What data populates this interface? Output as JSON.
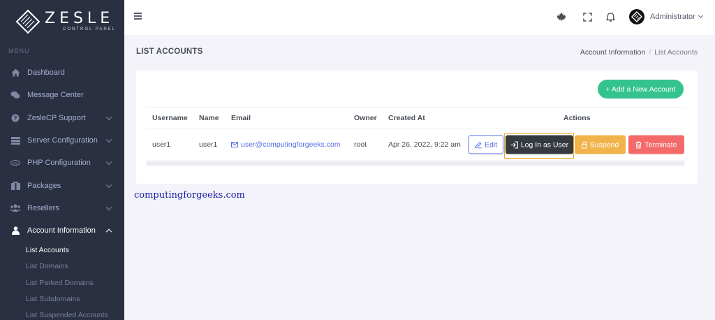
{
  "brand": {
    "name": "ZESLE",
    "tagline": "CONTROL PANEL"
  },
  "sidebar": {
    "menu_title": "MENU",
    "items": [
      {
        "label": "Dashboard",
        "icon": "home-icon",
        "has_children": false
      },
      {
        "label": "Message Center",
        "icon": "chat-icon",
        "has_children": false
      },
      {
        "label": "ZesleCP Support",
        "icon": "question-icon",
        "has_children": true
      },
      {
        "label": "Server Configuration",
        "icon": "server-icon",
        "has_children": true
      },
      {
        "label": "PHP Configuration",
        "icon": "php-icon",
        "has_children": true
      },
      {
        "label": "Packages",
        "icon": "package-icon",
        "has_children": true
      },
      {
        "label": "Resellers",
        "icon": "users-icon",
        "has_children": true
      },
      {
        "label": "Account Information",
        "icon": "user-icon",
        "has_children": true,
        "expanded": true
      }
    ],
    "subitems": [
      {
        "label": "List Accounts",
        "active": true
      },
      {
        "label": "List Domains"
      },
      {
        "label": "List Parked Domains"
      },
      {
        "label": "List Subdomains"
      },
      {
        "label": "List Suspended Accounts"
      }
    ]
  },
  "topbar": {
    "icons": [
      "menu-icon",
      "maple-leaf-icon",
      "fullscreen-icon",
      "bell-icon"
    ],
    "user_name": "Administrator"
  },
  "page": {
    "title": "LIST ACCOUNTS",
    "breadcrumb": [
      "Account Information",
      "/",
      "List Accounts"
    ]
  },
  "card": {
    "add_button": "+ Add a New Account",
    "columns": [
      "Username",
      "Name",
      "Email",
      "Owner",
      "Created At",
      "Actions"
    ],
    "rows": [
      {
        "username": "user1",
        "name": "user1",
        "email": "user@computingforgeeks.com",
        "owner": "root",
        "created_at": "Apr 26, 2022, 9:22 am",
        "actions": {
          "edit": "Edit",
          "login": "Log In as User",
          "suspend": "Suspend",
          "terminate": "Terminate"
        }
      }
    ]
  },
  "watermark": "computingforgeeks.com",
  "colors": {
    "sidebar_bg": "#2a3042",
    "page_bg": "#f3f3f9",
    "success": "#34c38f",
    "primary": "#556ee6",
    "dark": "#343a40",
    "warning": "#f1b44c",
    "danger": "#f46a6a",
    "highlight": "#f1a52d"
  }
}
